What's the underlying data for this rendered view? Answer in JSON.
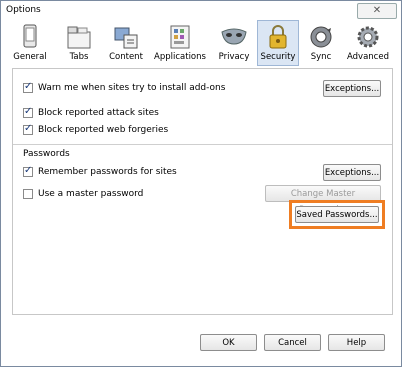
{
  "window": {
    "title": "Options",
    "close_glyph": "✕"
  },
  "toolbar": {
    "tabs": [
      {
        "label": "General",
        "icon": "general-icon"
      },
      {
        "label": "Tabs",
        "icon": "tabs-icon"
      },
      {
        "label": "Content",
        "icon": "content-icon"
      },
      {
        "label": "Applications",
        "icon": "applications-icon"
      },
      {
        "label": "Privacy",
        "icon": "privacy-icon"
      },
      {
        "label": "Security",
        "icon": "security-icon",
        "active": true
      },
      {
        "label": "Sync",
        "icon": "sync-icon"
      },
      {
        "label": "Advanced",
        "icon": "advanced-icon"
      }
    ]
  },
  "security": {
    "warn_addons": {
      "label": "Warn me when sites try to install add-ons",
      "checked": true
    },
    "exceptions_1": "Exceptions...",
    "block_attack": {
      "label": "Block reported attack sites",
      "checked": true
    },
    "block_forgeries": {
      "label": "Block reported web forgeries",
      "checked": true
    }
  },
  "passwords": {
    "group_label": "Passwords",
    "remember": {
      "label": "Remember passwords for sites",
      "checked": true
    },
    "exceptions_2": "Exceptions...",
    "master": {
      "label": "Use a master password",
      "checked": false
    },
    "change_master": "Change Master Password...",
    "saved": "Saved Passwords..."
  },
  "footer": {
    "ok": "OK",
    "cancel": "Cancel",
    "help": "Help"
  },
  "colors": {
    "highlight": "#ef7d22",
    "active_tab_bg": "#dbe6f4"
  }
}
